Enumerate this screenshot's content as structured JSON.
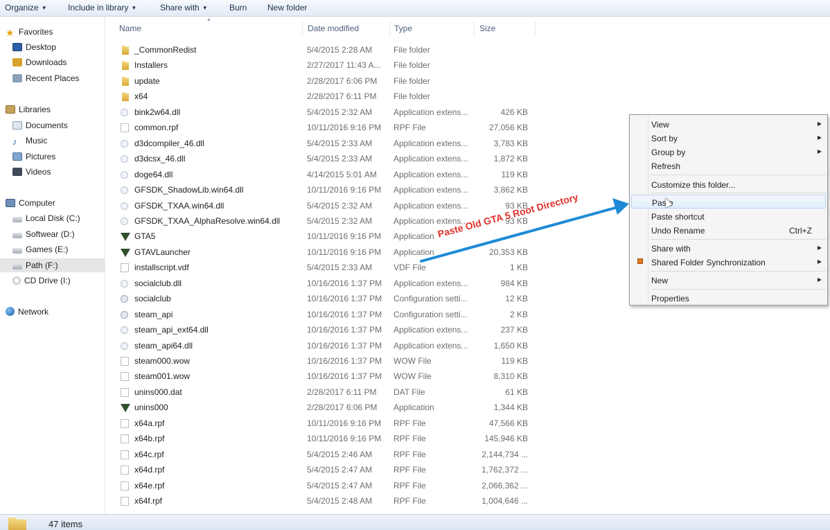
{
  "toolbar": {
    "organize": "Organize",
    "include_in_library": "Include in library",
    "share_with": "Share with",
    "burn": "Burn",
    "new_folder": "New folder"
  },
  "nav": {
    "favorites": "Favorites",
    "desktop": "Desktop",
    "downloads": "Downloads",
    "recent_places": "Recent Places",
    "libraries": "Libraries",
    "documents": "Documents",
    "music": "Music",
    "pictures": "Pictures",
    "videos": "Videos",
    "computer": "Computer",
    "local_disk": "Local Disk (C:)",
    "softwear": "Softwear (D:)",
    "games": "Games (E:)",
    "path": "Path (F:)",
    "cd_drive": "CD Drive (I:)",
    "network": "Network"
  },
  "columns": {
    "name": "Name",
    "date_modified": "Date modified",
    "type": "Type",
    "size": "Size"
  },
  "files": [
    {
      "name": "_CommonRedist",
      "date": "5/4/2015 2:28 AM",
      "type": "File folder",
      "size": "",
      "icon": "folder"
    },
    {
      "name": "Installers",
      "date": "2/27/2017 11:43 A...",
      "type": "File folder",
      "size": "",
      "icon": "folder"
    },
    {
      "name": "update",
      "date": "2/28/2017 6:06 PM",
      "type": "File folder",
      "size": "",
      "icon": "folder"
    },
    {
      "name": "x64",
      "date": "2/28/2017 6:11 PM",
      "type": "File folder",
      "size": "",
      "icon": "folder"
    },
    {
      "name": "bink2w64.dll",
      "date": "5/4/2015 2:32 AM",
      "type": "Application extens...",
      "size": "426 KB",
      "icon": "dll"
    },
    {
      "name": "common.rpf",
      "date": "10/11/2016 9:16 PM",
      "type": "RPF File",
      "size": "27,056 KB",
      "icon": "file"
    },
    {
      "name": "d3dcompiler_46.dll",
      "date": "5/4/2015 2:33 AM",
      "type": "Application extens...",
      "size": "3,783 KB",
      "icon": "dll"
    },
    {
      "name": "d3dcsx_46.dll",
      "date": "5/4/2015 2:33 AM",
      "type": "Application extens...",
      "size": "1,872 KB",
      "icon": "dll"
    },
    {
      "name": "doge64.dll",
      "date": "4/14/2015 5:01 AM",
      "type": "Application extens...",
      "size": "119 KB",
      "icon": "dll"
    },
    {
      "name": "GFSDK_ShadowLib.win64.dll",
      "date": "10/11/2016 9:16 PM",
      "type": "Application extens...",
      "size": "3,862 KB",
      "icon": "dll"
    },
    {
      "name": "GFSDK_TXAA.win64.dll",
      "date": "5/4/2015 2:32 AM",
      "type": "Application extens...",
      "size": "93 KB",
      "icon": "dll"
    },
    {
      "name": "GFSDK_TXAA_AlphaResolve.win64.dll",
      "date": "5/4/2015 2:32 AM",
      "type": "Application extens...",
      "size": "93 KB",
      "icon": "dll"
    },
    {
      "name": "GTA5",
      "date": "10/11/2016 9:16 PM",
      "type": "Application",
      "size": "",
      "icon": "gta"
    },
    {
      "name": "GTAVLauncher",
      "date": "10/11/2016 9:16 PM",
      "type": "Application",
      "size": "20,353 KB",
      "icon": "gta"
    },
    {
      "name": "installscript.vdf",
      "date": "5/4/2015 2:33 AM",
      "type": "VDF File",
      "size": "1 KB",
      "icon": "file"
    },
    {
      "name": "socialclub.dll",
      "date": "10/16/2016 1:37 PM",
      "type": "Application extens...",
      "size": "984 KB",
      "icon": "dll"
    },
    {
      "name": "socialclub",
      "date": "10/16/2016 1:37 PM",
      "type": "Configuration setti...",
      "size": "12 KB",
      "icon": "cfg"
    },
    {
      "name": "steam_api",
      "date": "10/16/2016 1:37 PM",
      "type": "Configuration setti...",
      "size": "2 KB",
      "icon": "cfg"
    },
    {
      "name": "steam_api_ext64.dll",
      "date": "10/16/2016 1:37 PM",
      "type": "Application extens...",
      "size": "237 KB",
      "icon": "dll"
    },
    {
      "name": "steam_api64.dll",
      "date": "10/16/2016 1:37 PM",
      "type": "Application extens...",
      "size": "1,650 KB",
      "icon": "dll"
    },
    {
      "name": "steam000.wow",
      "date": "10/16/2016 1:37 PM",
      "type": "WOW File",
      "size": "119 KB",
      "icon": "file"
    },
    {
      "name": "steam001.wow",
      "date": "10/16/2016 1:37 PM",
      "type": "WOW File",
      "size": "8,310 KB",
      "icon": "file"
    },
    {
      "name": "unins000.dat",
      "date": "2/28/2017 6:11 PM",
      "type": "DAT File",
      "size": "61 KB",
      "icon": "file"
    },
    {
      "name": "unins000",
      "date": "2/28/2017 6:06 PM",
      "type": "Application",
      "size": "1,344 KB",
      "icon": "gta"
    },
    {
      "name": "x64a.rpf",
      "date": "10/11/2016 9:16 PM",
      "type": "RPF File",
      "size": "47,566 KB",
      "icon": "file"
    },
    {
      "name": "x64b.rpf",
      "date": "10/11/2016 9:16 PM",
      "type": "RPF File",
      "size": "145,946 KB",
      "icon": "file"
    },
    {
      "name": "x64c.rpf",
      "date": "5/4/2015 2:46 AM",
      "type": "RPF File",
      "size": "2,144,734 ...",
      "icon": "file"
    },
    {
      "name": "x64d.rpf",
      "date": "5/4/2015 2:47 AM",
      "type": "RPF File",
      "size": "1,762,372 ...",
      "icon": "file"
    },
    {
      "name": "x64e.rpf",
      "date": "5/4/2015 2:47 AM",
      "type": "RPF File",
      "size": "2,066,362 ...",
      "icon": "file"
    },
    {
      "name": "x64f.rpf",
      "date": "5/4/2015 2:48 AM",
      "type": "RPF File",
      "size": "1,004,646 ...",
      "icon": "file"
    }
  ],
  "status": {
    "items_count": "47 items"
  },
  "context_menu": {
    "view": "View",
    "sort_by": "Sort by",
    "group_by": "Group by",
    "refresh": "Refresh",
    "customize": "Customize this folder...",
    "paste": "Paste",
    "paste_shortcut": "Paste shortcut",
    "undo_rename": "Undo Rename",
    "undo_shortcut": "Ctrl+Z",
    "share_with": "Share with",
    "shared_folder_sync": "Shared Folder Synchronization",
    "new": "New",
    "properties": "Properties"
  },
  "annotation": {
    "text": "Paste Old GTA 5 Root Directory",
    "color": "#e0312a",
    "arrow_color": "#1e8ad6"
  }
}
